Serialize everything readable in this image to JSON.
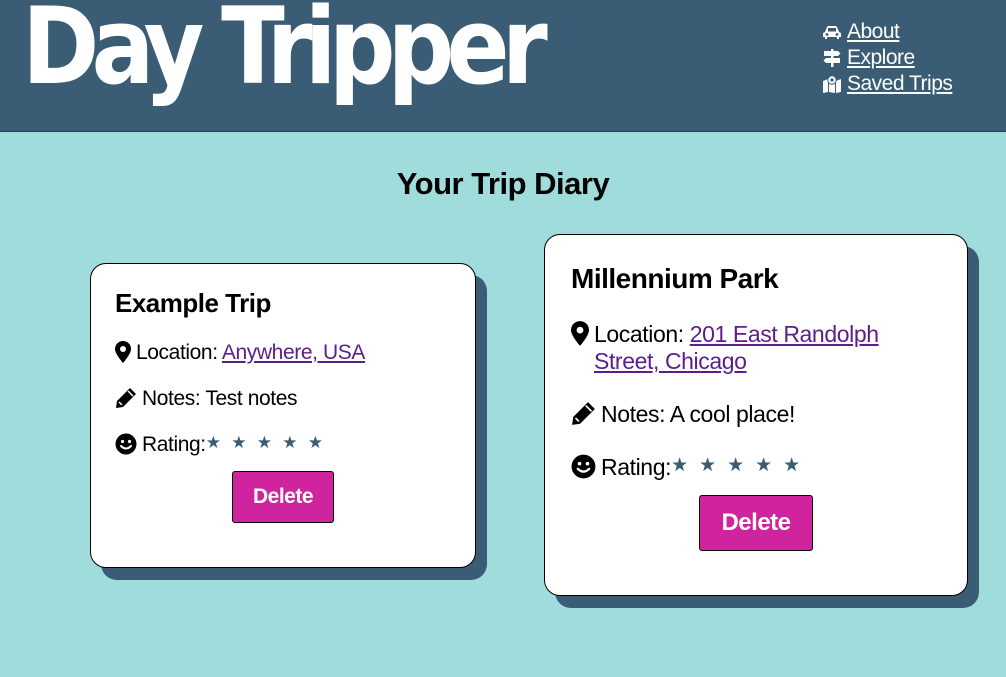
{
  "app": {
    "logo_text": "Day Tripper"
  },
  "nav": {
    "items": [
      {
        "label": "About",
        "icon": "car-icon"
      },
      {
        "label": "Explore",
        "icon": "signpost-icon"
      },
      {
        "label": "Saved Trips",
        "icon": "map-marker-icon"
      }
    ]
  },
  "page": {
    "title": "Your Trip Diary"
  },
  "trips": [
    {
      "name": "Example Trip",
      "location_label": "Location: ",
      "location": "Anywhere, USA",
      "notes_label": "Notes: ",
      "notes": "Test notes",
      "rating_label": "Rating:",
      "rating_stars": 5,
      "delete_label": "Delete"
    },
    {
      "name": "Millennium Park",
      "location_label": "Location: ",
      "location": "201 East Randolph Street, Chicago",
      "notes_label": "Notes: ",
      "notes": "A cool place!",
      "rating_label": "Rating:",
      "rating_stars": 5,
      "delete_label": "Delete"
    }
  ],
  "colors": {
    "header_bg": "#3a5d75",
    "page_bg": "#a0dcdc",
    "delete_button": "#d0239e",
    "star": "#3a5d75",
    "link": "#5b1e8a"
  }
}
